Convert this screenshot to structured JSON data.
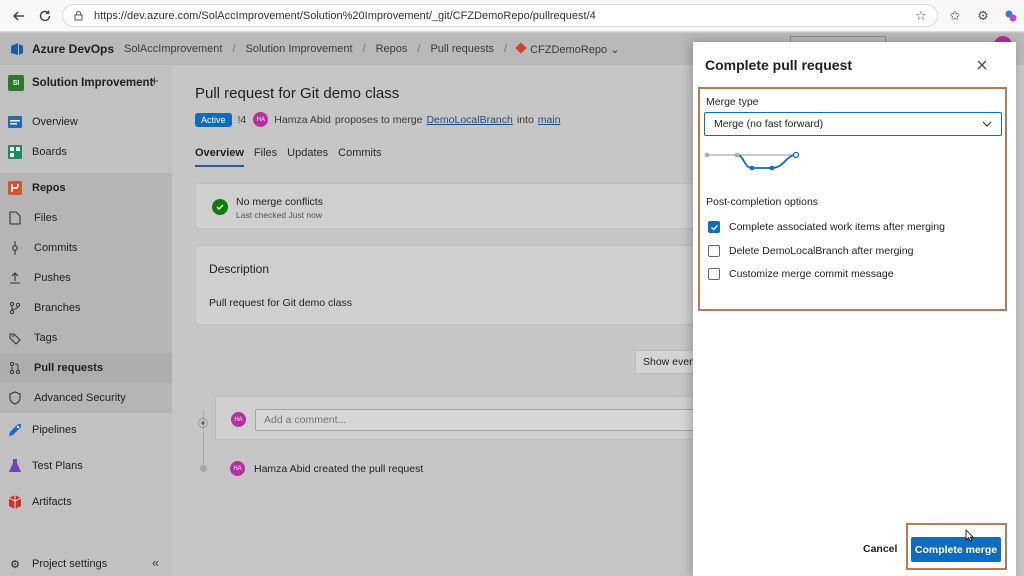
{
  "browser": {
    "url": "https://dev.azure.com/SolAccImprovement/Solution%20Improvement/_git/CFZDemoRepo/pullrequest/4"
  },
  "header": {
    "brand": "Azure DevOps",
    "breadcrumbs": [
      "SolAccImprovement",
      "Solution Improvement",
      "Repos",
      "Pull requests",
      "CFZDemoRepo"
    ],
    "separator": "/"
  },
  "sidebar": {
    "project_badge": "SI",
    "project_name": "Solution Improvement",
    "add_symbol": "+",
    "items": [
      {
        "label": "Overview",
        "icon": "overview-icon"
      },
      {
        "label": "Boards",
        "icon": "boards-icon"
      },
      {
        "label": "Repos",
        "icon": "repos-icon"
      },
      {
        "label": "Files",
        "icon": "file-icon"
      },
      {
        "label": "Commits",
        "icon": "commit-icon"
      },
      {
        "label": "Pushes",
        "icon": "push-icon"
      },
      {
        "label": "Branches",
        "icon": "branch-icon"
      },
      {
        "label": "Tags",
        "icon": "tag-icon"
      },
      {
        "label": "Pull requests",
        "icon": "pull-request-icon"
      },
      {
        "label": "Advanced Security",
        "icon": "shield-icon"
      },
      {
        "label": "Pipelines",
        "icon": "pipelines-icon"
      },
      {
        "label": "Test Plans",
        "icon": "test-plans-icon"
      },
      {
        "label": "Artifacts",
        "icon": "artifacts-icon"
      }
    ],
    "settings_label": "Project settings",
    "collapse_symbol": "«"
  },
  "pr": {
    "title": "Pull request for Git demo class",
    "status": "Active",
    "id": "!4",
    "author_initials": "HA",
    "author": "Hamza Abid",
    "proposes_text": "proposes to merge",
    "source_branch": "DemoLocalBranch",
    "into_text": "into",
    "target_branch": "main",
    "tabs": [
      "Overview",
      "Files",
      "Updates",
      "Commits"
    ],
    "merge_status_title": "No merge conflicts",
    "merge_status_sub": "Last checked Just now",
    "description_heading": "Description",
    "description_text": "Pull request for Git demo class",
    "show_button": "Show every",
    "comment_placeholder": "Add a comment...",
    "activity_text": "Hamza Abid created the pull request"
  },
  "dialog": {
    "title": "Complete pull request",
    "merge_type_label": "Merge type",
    "merge_type_value": "Merge (no fast forward)",
    "post_completion_label": "Post-completion options",
    "options": [
      {
        "label": "Complete associated work items after merging",
        "checked": true
      },
      {
        "label": "Delete DemoLocalBranch after merging",
        "checked": false
      },
      {
        "label": "Customize merge commit message",
        "checked": false
      }
    ],
    "cancel_label": "Cancel",
    "complete_label": "Complete merge"
  },
  "colors": {
    "accent": "#0f6cbd",
    "highlight_border": "#b57a57",
    "success": "#107c10",
    "avatar": "#b4309b"
  }
}
